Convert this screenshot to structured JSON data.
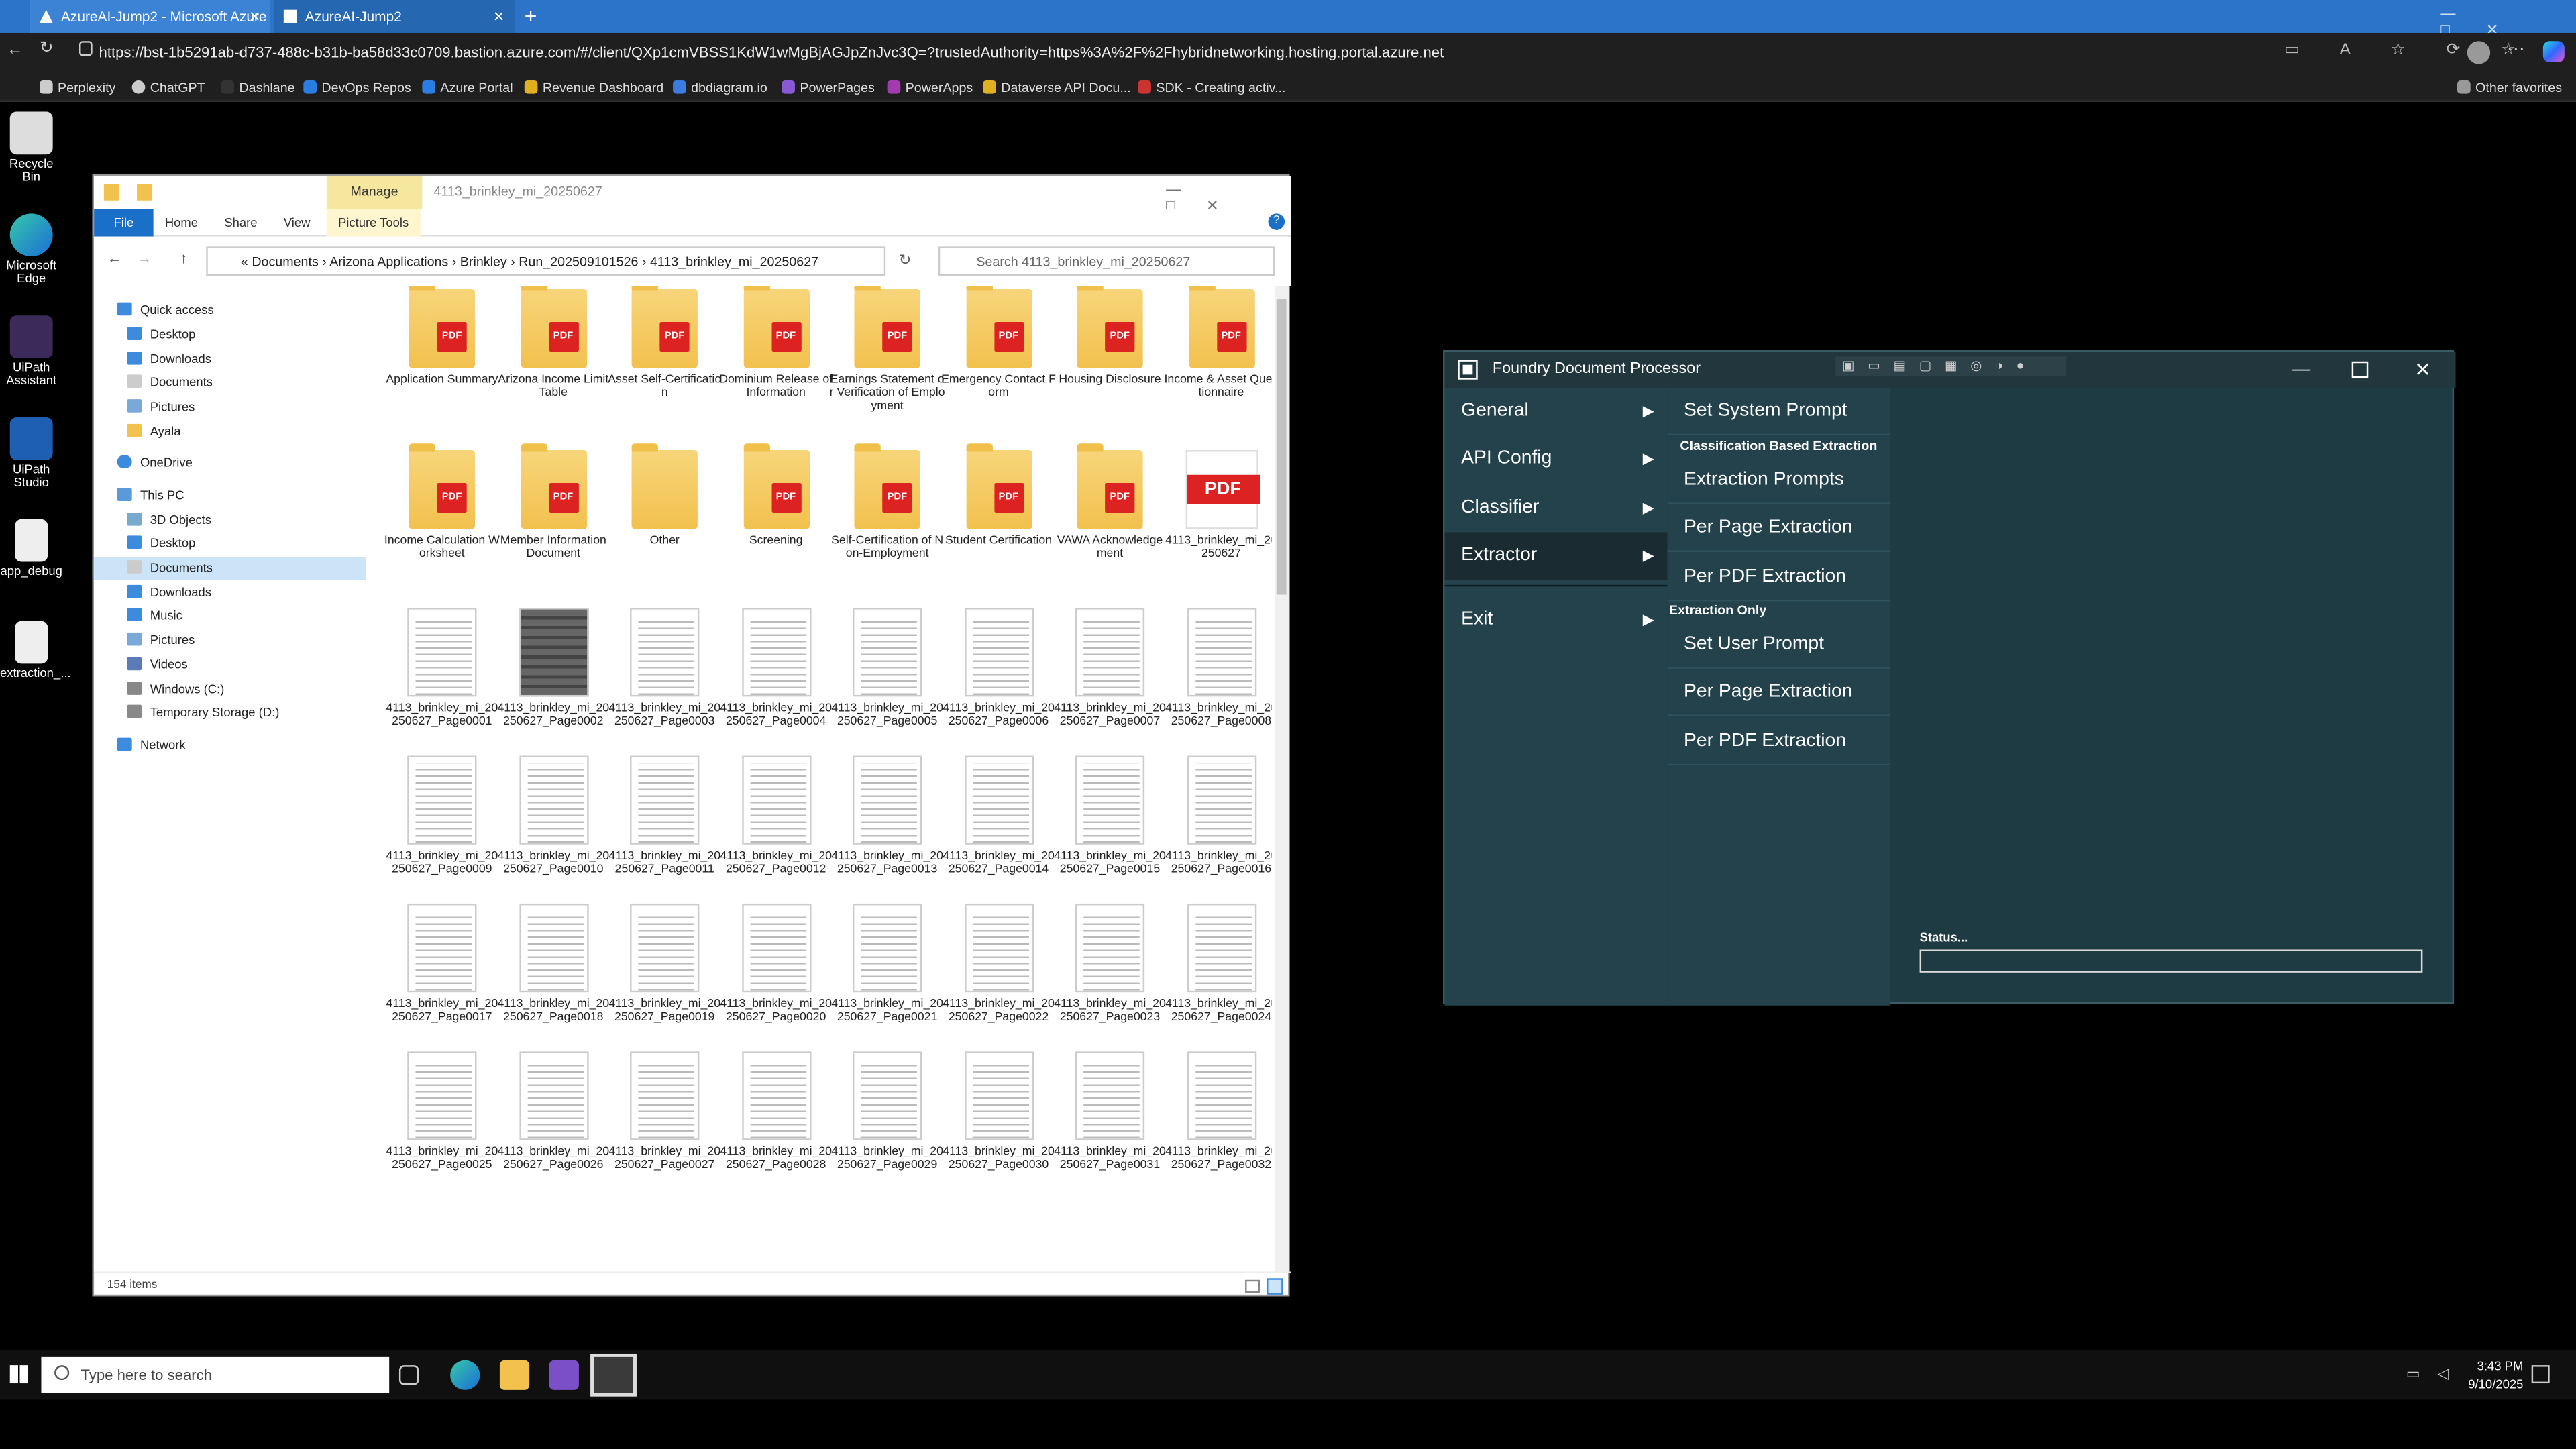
{
  "browser": {
    "tabs": [
      {
        "label": "AzureAI-Jump2 - Microsoft Azure"
      },
      {
        "label": "AzureAI-Jump2"
      }
    ],
    "new_tab": "+",
    "url": "https://bst-1b5291ab-d737-488c-b31b-ba58d33c0709.bastion.azure.com/#/client/QXp1cmVBSS1KdW1wMgBjAGJpZnJvc3Q=?trustedAuthority=https%3A%2F%2Fhybridnetworking.hosting.portal.azure.net",
    "favorites": [
      "Perplexity",
      "ChatGPT",
      "Dashlane",
      "DevOps Repos",
      "Azure Portal",
      "Revenue Dashboard",
      "dbdiagram.io",
      "PowerPages",
      "PowerApps",
      "Dataverse API Docu...",
      "SDK - Creating activ..."
    ],
    "other_favorites": "Other favorites",
    "colors": {
      "tabbar": "#2b74c9",
      "toolbar": "#1f1f1f"
    }
  },
  "desktop_icons": [
    "Recycle Bin",
    "Microsoft Edge",
    "UiPath Assistant",
    "UiPath Studio",
    "app_debug",
    "extraction_..."
  ],
  "explorer": {
    "title": "4113_brinkley_mi_20250627",
    "manage": "Manage",
    "ribbon_tabs": [
      "File",
      "Home",
      "Share",
      "View",
      "Picture Tools"
    ],
    "breadcrumb": [
      "Documents",
      "Arizona Applications",
      "Brinkley",
      "Run_20250910 1526",
      "4113_brinkley_mi_20250627"
    ],
    "breadcrumb_text": "« Documents  ›  Arizona Applications  ›  Brinkley  ›  Run_202509101526  ›  4113_brinkley_mi_20250627",
    "search_placeholder": "Search 4113_brinkley_mi_20250627",
    "nav": [
      "Quick access",
      "Desktop",
      "Downloads",
      "Documents",
      "Pictures",
      "Ayala",
      "OneDrive",
      "This PC",
      "3D Objects",
      "Desktop",
      "Documents",
      "Downloads",
      "Music",
      "Pictures",
      "Videos",
      "Windows (C:)",
      "Temporary Storage (D:)",
      "Network"
    ],
    "folders": [
      "Application Summary",
      "Arizona Income Limit Table",
      "Asset Self-Certification",
      "Dominium Release of Information",
      "Earnings Statement or Verification of Employment",
      "Emergency Contact Form",
      "Housing Disclosure",
      "Income & Asset Questionnaire",
      "Income Calculation Worksheet",
      "Member Information Document",
      "Other",
      "Screening",
      "Self-Certification of Non-Employment",
      "Student Certification",
      "VAWA Acknowledgement"
    ],
    "pdf_file": "4113_brinkley_mi_20250627",
    "page_files": [
      "4113_brinkley_mi_20250627_Page0001",
      "4113_brinkley_mi_20250627_Page0002",
      "4113_brinkley_mi_20250627_Page0003",
      "4113_brinkley_mi_20250627_Page0004",
      "4113_brinkley_mi_20250627_Page0005",
      "4113_brinkley_mi_20250627_Page0006",
      "4113_brinkley_mi_20250627_Page0007",
      "4113_brinkley_mi_20250627_Page0008",
      "4113_brinkley_mi_20250627_Page0009",
      "4113_brinkley_mi_20250627_Page0010",
      "4113_brinkley_mi_20250627_Page0011",
      "4113_brinkley_mi_20250627_Page0012",
      "4113_brinkley_mi_20250627_Page0013",
      "4113_brinkley_mi_20250627_Page0014",
      "4113_brinkley_mi_20250627_Page0015",
      "4113_brinkley_mi_20250627_Page0016",
      "4113_brinkley_mi_20250627_Page0017",
      "4113_brinkley_mi_20250627_Page0018",
      "4113_brinkley_mi_20250627_Page0019",
      "4113_brinkley_mi_20250627_Page0020",
      "4113_brinkley_mi_20250627_Page0021",
      "4113_brinkley_mi_20250627_Page0022",
      "4113_brinkley_mi_20250627_Page0023",
      "4113_brinkley_mi_20250627_Page0024",
      "4113_brinkley_mi_20250627_Page0025",
      "4113_brinkley_mi_20250627_Page0026",
      "4113_brinkley_mi_20250627_Page0027",
      "4113_brinkley_mi_20250627_Page0028",
      "4113_brinkley_mi_20250627_Page0029",
      "4113_brinkley_mi_20250627_Page0030",
      "4113_brinkley_mi_20250627_Page0031",
      "4113_brinkley_mi_20250627_Page0032"
    ],
    "item_count": "154 items"
  },
  "fdp": {
    "title": "Foundry Document Processor",
    "menu": [
      "General",
      "API Config",
      "Classifier",
      "Extractor",
      "Exit"
    ],
    "active_menu": "Extractor",
    "submenu": {
      "set_system_prompt": "Set System Prompt",
      "header1": "Classification Based Extraction",
      "extraction_prompts": "Extraction Prompts",
      "per_page_1": "Per Page Extraction",
      "per_pdf_1": "Per PDF Extraction",
      "header2": "Extraction Only",
      "set_user_prompt": "Set User Prompt",
      "per_page_2": "Per Page Extraction",
      "per_pdf_2": "Per PDF Extraction"
    },
    "status_label": "Status...",
    "colors": {
      "bg": "#1e3b44",
      "menu": "#23424b"
    }
  },
  "taskbar": {
    "search_placeholder": "Type here to search",
    "time": "3:43 PM",
    "date": "9/10/2025"
  }
}
